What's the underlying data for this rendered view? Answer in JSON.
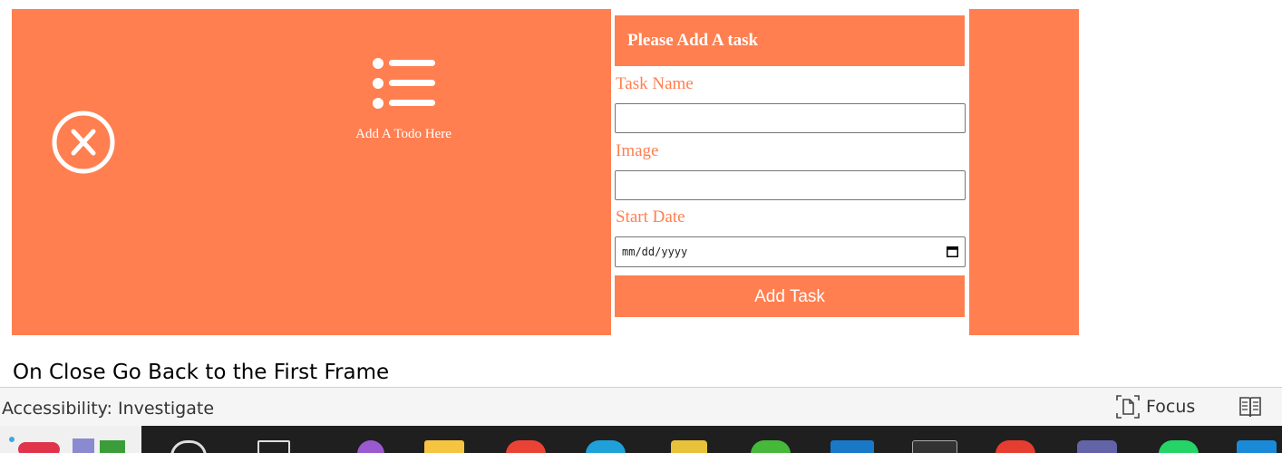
{
  "left_panel": {
    "add_todo_label": "Add A Todo Here"
  },
  "form": {
    "header": "Please Add A task",
    "task_name_label": "Task Name",
    "image_label": "Image",
    "start_date_label": "Start Date",
    "task_name_value": "",
    "image_value": "",
    "date_placeholder": "mm/dd/yyyy",
    "submit_label": "Add Task"
  },
  "caption": "On Close Go Back to the First Frame",
  "status_bar": {
    "accessibility": "Accessibility: Investigate",
    "focus": "Focus"
  },
  "colors": {
    "accent": "#ff7f50",
    "taskbar": "#1f1f1f"
  },
  "taskbar": {
    "icons": [
      "widgets-icon",
      "search-icon",
      "task-view-icon",
      "visual-studio-icon",
      "file-explorer-icon",
      "chrome-icon",
      "edge-icon",
      "database-icon",
      "green-app-icon",
      "outlook-icon",
      "terminal-icon",
      "red-app-icon",
      "teams-icon",
      "whatsapp-icon",
      "vscode-icon"
    ]
  }
}
